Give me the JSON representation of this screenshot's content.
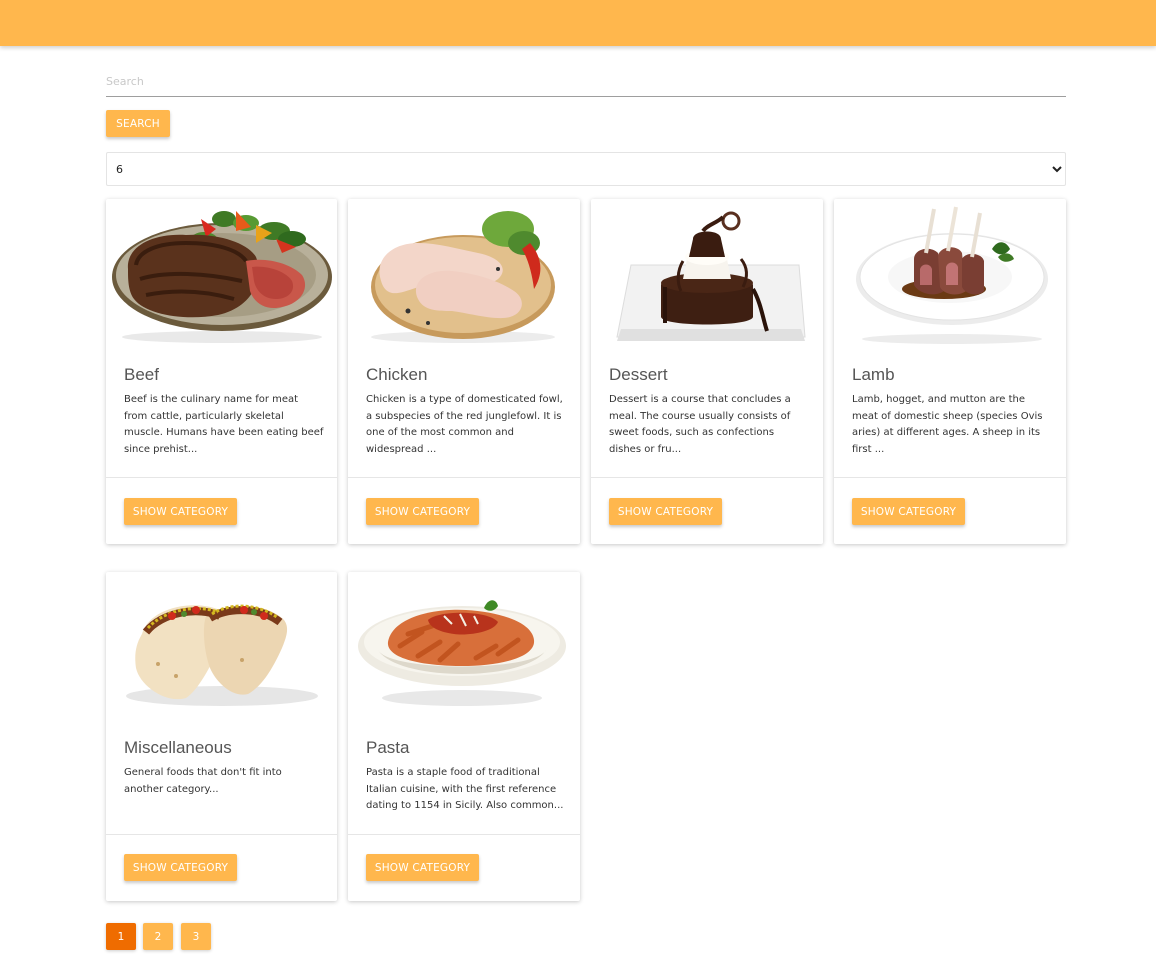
{
  "search": {
    "placeholder": "Search",
    "button_label": "SEARCH"
  },
  "page_size": {
    "selected": "6",
    "options": [
      "6"
    ]
  },
  "colors": {
    "accent": "#ffb74d",
    "accent_active": "#ef6c00"
  },
  "categories": [
    {
      "title": "Beef",
      "description": "Beef is the culinary name for meat from cattle, particularly skeletal muscle. Humans have been eating beef since prehist...",
      "image_icon": "steak-plate-image",
      "button_label": "SHOW CATEGORY"
    },
    {
      "title": "Chicken",
      "description": "Chicken is a type of domesticated fowl, a subspecies of the red junglefowl. It is one of the most common and widespread ...",
      "image_icon": "raw-chicken-image",
      "button_label": "SHOW CATEGORY"
    },
    {
      "title": "Dessert",
      "description": "Dessert is a course that concludes a meal. The course usually consists of sweet foods, such as confections dishes or fru...",
      "image_icon": "chocolate-cake-image",
      "button_label": "SHOW CATEGORY"
    },
    {
      "title": "Lamb",
      "description": "Lamb, hogget, and mutton are the meat of domestic sheep (species Ovis aries) at different ages. A sheep in its first ...",
      "image_icon": "lamb-chops-image",
      "button_label": "SHOW CATEGORY"
    },
    {
      "title": "Miscellaneous",
      "description": "General foods that don't fit into another category...",
      "image_icon": "tacos-image",
      "button_label": "SHOW CATEGORY"
    },
    {
      "title": "Pasta",
      "description": "Pasta is a staple food of traditional Italian cuisine, with the first reference dating to 1154 in Sicily. Also common...",
      "image_icon": "pasta-bowl-image",
      "button_label": "SHOW CATEGORY"
    }
  ],
  "pagination": {
    "current": "1",
    "pages": [
      "1",
      "2",
      "3"
    ]
  }
}
